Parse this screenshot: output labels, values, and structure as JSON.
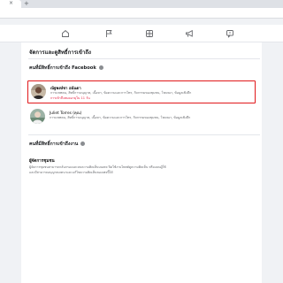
{
  "browser": {
    "tab_close": "×",
    "new_tab": "+"
  },
  "nav": {
    "icons": [
      "home-icon",
      "flag-icon",
      "grid-icon",
      "megaphone-icon",
      "message-icon"
    ]
  },
  "page": {
    "heading": "จัดการและดูสิทธิ์การเข้าถึง",
    "facebook_access_title": "คนที่มีสิทธิ์การเข้าถึง Facebook",
    "people": [
      {
        "name": "ณัฐพงษ์ชา อนันตา",
        "permissions": "การแชทคน, สิทธิ์การอนุญาต, เนื้อหา, ข้อความและการโทร, กิจกรรมของชุมชน, โฆษณา, ข้อมูลเชิงลึก",
        "status": "การเข้าถึงหมดอายุใน 11 วัน",
        "selected": true
      },
      {
        "name": "Juliet Torres (คุณ)",
        "permissions": "การแชทคน, สิทธิ์การอนุญาต, เนื้อหา, ข้อความและการโทร, กิจกรรมของชุมชน, โฆษณา, ข้อมูลเชิงลึก",
        "status": "",
        "selected": false
      }
    ],
    "task_access_title": "คนที่มีสิทธิ์การเข้าถึงงาน",
    "role": {
      "title": "ผู้จัดการชุมชน",
      "desc_line1": "ผู้จัดการชุมชนสามารถกลั่นกรองและลบความคิดเห็นบนเพจ ปิดใช้งานโพสต์ดูความคิดเห็น หรือแบนผู้ใช้",
      "desc_line2": "และมีสามารถอนุญาตเจตนาและแก้ไขความคิดเห็นของเพจนี้ได้"
    }
  },
  "colors": {
    "selection_border": "#e0181b",
    "status_red": "#e41e3f"
  }
}
